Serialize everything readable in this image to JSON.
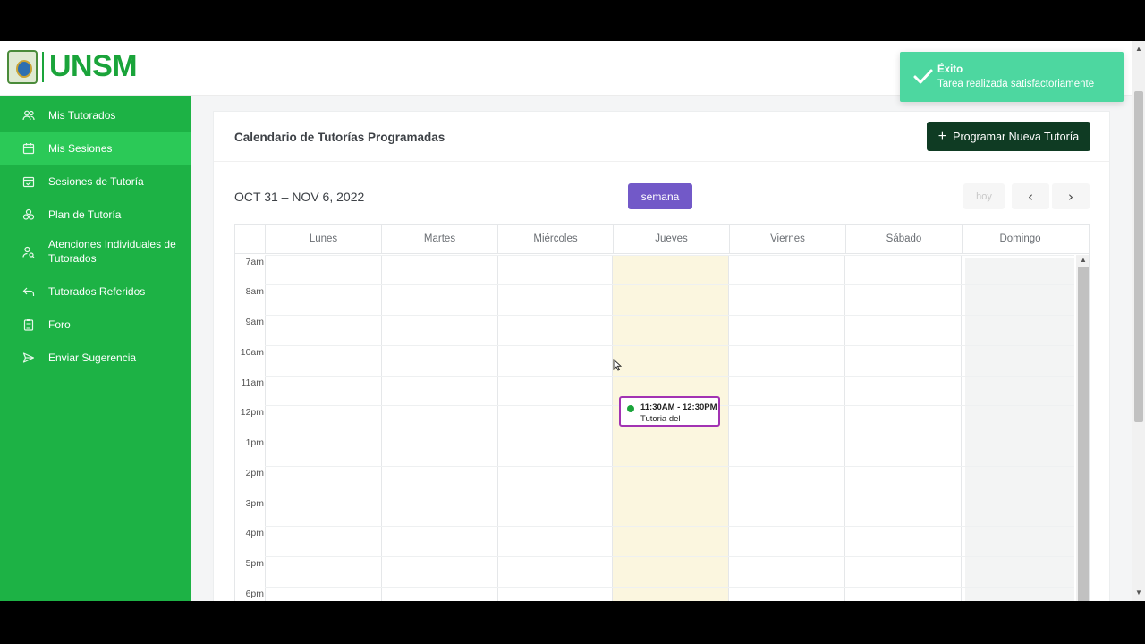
{
  "brand": {
    "name": "UNSM"
  },
  "sidebar": {
    "items": [
      {
        "label": "Mis Tutorados",
        "icon": "users-icon"
      },
      {
        "label": "Mis Sesiones",
        "icon": "calendar-icon",
        "active": true
      },
      {
        "label": "Sesiones de Tutoría",
        "icon": "calendar-check-icon"
      },
      {
        "label": "Plan de Tutoría",
        "icon": "layers-icon"
      },
      {
        "label": "Atenciones Individuales de Tutorados",
        "icon": "user-search-icon"
      },
      {
        "label": "Tutorados Referidos",
        "icon": "arrow-back-icon"
      },
      {
        "label": "Foro",
        "icon": "clipboard-icon"
      },
      {
        "label": "Enviar Sugerencia",
        "icon": "send-icon"
      }
    ]
  },
  "card": {
    "title": "Calendario de Tutorías Programadas",
    "new_button": "Programar Nueva Tutoría"
  },
  "calendar": {
    "range": "OCT 31 – NOV 6, 2022",
    "view_button": "semana",
    "today_button": "hoy",
    "prev_icon": "chevron-left-icon",
    "next_icon": "chevron-right-icon",
    "days": [
      "Lunes",
      "Martes",
      "Miércoles",
      "Jueves",
      "Viernes",
      "Sábado",
      "Domingo"
    ],
    "times": [
      "7am",
      "8am",
      "9am",
      "10am",
      "11am",
      "12pm",
      "1pm",
      "2pm",
      "3pm",
      "4pm",
      "5pm",
      "6pm"
    ],
    "event": {
      "time": "11:30AM - 12:30PM",
      "title": "Tutoria del",
      "day": "Jueves"
    }
  },
  "toast": {
    "title": "Éxito",
    "message": "Tarea realizada satisfactoriamente"
  },
  "colors": {
    "sidebar": "#1db245",
    "sidebar_active": "#2bc957",
    "primary_dark": "#0f3b23",
    "view_button": "#7259c8",
    "today_highlight": "#fbf6df",
    "event_border": "#a233b3",
    "toast": "#4dd7a0"
  }
}
